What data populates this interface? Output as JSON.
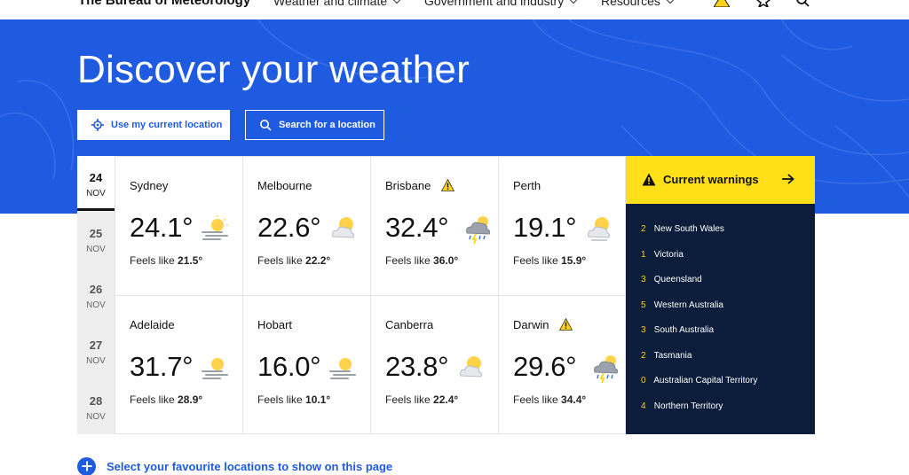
{
  "nav": {
    "brand": "The Bureau of Meteorology",
    "items": [
      {
        "label": "Weather and climate"
      },
      {
        "label": "Government and industry"
      },
      {
        "label": "Resources"
      }
    ]
  },
  "hero": {
    "title": "Discover your weather",
    "location_button": "Use my current location",
    "search_button": "Search for a location"
  },
  "days": [
    {
      "day": "24",
      "month": "NOV",
      "selected": true
    },
    {
      "day": "25",
      "month": "NOV",
      "selected": false
    },
    {
      "day": "26",
      "month": "NOV",
      "selected": false
    },
    {
      "day": "27",
      "month": "NOV",
      "selected": false
    },
    {
      "day": "28",
      "month": "NOV",
      "selected": false
    }
  ],
  "cities": [
    {
      "name": "Sydney",
      "temp": "24.1°",
      "feels_label": "Feels like",
      "feels": "21.5°",
      "icon": "haze-sun-icon",
      "warning": false
    },
    {
      "name": "Melbourne",
      "temp": "22.6°",
      "feels_label": "Feels like",
      "feels": "22.2°",
      "icon": "partly-cloudy-icon",
      "warning": false
    },
    {
      "name": "Brisbane",
      "temp": "32.4°",
      "feels_label": "Feels like",
      "feels": "36.0°",
      "icon": "storm-icon",
      "warning": true
    },
    {
      "name": "Perth",
      "temp": "19.1°",
      "feels_label": "Feels like",
      "feels": "15.9°",
      "icon": "partly-cloudy-icon",
      "warning": false
    },
    {
      "name": "Adelaide",
      "temp": "31.7°",
      "feels_label": "Feels like",
      "feels": "28.9°",
      "icon": "haze-sun-icon",
      "warning": false
    },
    {
      "name": "Hobart",
      "temp": "16.0°",
      "feels_label": "Feels like",
      "feels": "10.1°",
      "icon": "haze-sun-icon",
      "warning": false
    },
    {
      "name": "Canberra",
      "temp": "23.8°",
      "feels_label": "Feels like",
      "feels": "22.4°",
      "icon": "partly-cloudy-icon",
      "warning": false
    },
    {
      "name": "Darwin",
      "temp": "29.6°",
      "feels_label": "Feels like",
      "feels": "34.4°",
      "icon": "storm-icon",
      "warning": true
    }
  ],
  "warnings": {
    "title": "Current warnings",
    "items": [
      {
        "count": "2",
        "region": "New South Wales"
      },
      {
        "count": "1",
        "region": "Victoria"
      },
      {
        "count": "3",
        "region": "Queensland"
      },
      {
        "count": "5",
        "region": "Western Australia"
      },
      {
        "count": "3",
        "region": "South Australia"
      },
      {
        "count": "2",
        "region": "Tasmania"
      },
      {
        "count": "0",
        "region": "Australian Capital Territory"
      },
      {
        "count": "4",
        "region": "Northern Territory"
      }
    ]
  },
  "favourites": {
    "label": "Select your favourite locations to show on this page"
  },
  "colors": {
    "accent": "#1f5be0",
    "warning": "#ffe018",
    "navy": "#0b1d3a"
  }
}
